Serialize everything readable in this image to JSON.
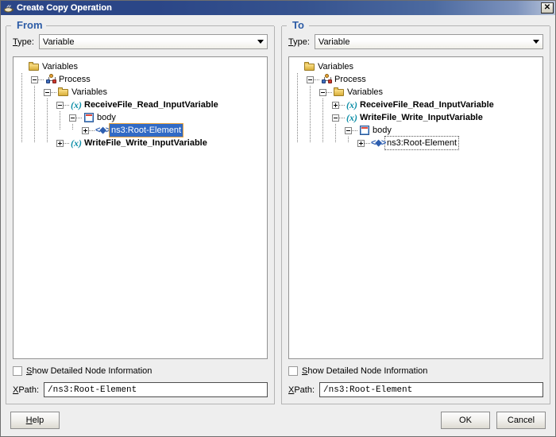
{
  "window": {
    "title": "Create Copy Operation",
    "icon": "coffee-cup-icon",
    "close_label": "✕"
  },
  "panels": [
    {
      "id": "from",
      "title": "From",
      "type_label": "Type:",
      "type_mnemonic": "T",
      "type_value": "Variable",
      "tree": [
        {
          "depth": 0,
          "icon": "folder-icon",
          "label": "Variables",
          "bold": false,
          "expander": "none",
          "state": "normal"
        },
        {
          "depth": 1,
          "icon": "process-icon",
          "label": "Process",
          "bold": false,
          "expander": "minus",
          "state": "normal"
        },
        {
          "depth": 2,
          "icon": "folder-icon",
          "label": "Variables",
          "bold": false,
          "expander": "minus",
          "state": "normal"
        },
        {
          "depth": 3,
          "icon": "variable-icon",
          "label": "ReceiveFile_Read_InputVariable",
          "bold": true,
          "expander": "minus",
          "state": "normal"
        },
        {
          "depth": 4,
          "icon": "body-icon",
          "label": "body",
          "bold": false,
          "expander": "minus",
          "state": "normal"
        },
        {
          "depth": 5,
          "icon": "element-icon",
          "label": "ns3:Root-Element",
          "bold": false,
          "expander": "plus",
          "state": "selected"
        },
        {
          "depth": 3,
          "icon": "variable-icon",
          "label": "WriteFile_Write_InputVariable",
          "bold": true,
          "expander": "plus",
          "state": "normal"
        }
      ],
      "checkbox_label": "Show Detailed Node Information",
      "checkbox_mnemonic": "S",
      "checkbox_checked": false,
      "xpath_label": "XPath:",
      "xpath_mnemonic": "X",
      "xpath_value": "/ns3:Root-Element"
    },
    {
      "id": "to",
      "title": "To",
      "type_label": "Type:",
      "type_mnemonic": "T",
      "type_value": "Variable",
      "tree": [
        {
          "depth": 0,
          "icon": "folder-icon",
          "label": "Variables",
          "bold": false,
          "expander": "none",
          "state": "normal"
        },
        {
          "depth": 1,
          "icon": "process-icon",
          "label": "Process",
          "bold": false,
          "expander": "minus",
          "state": "normal"
        },
        {
          "depth": 2,
          "icon": "folder-icon",
          "label": "Variables",
          "bold": false,
          "expander": "minus",
          "state": "normal"
        },
        {
          "depth": 3,
          "icon": "variable-icon",
          "label": "ReceiveFile_Read_InputVariable",
          "bold": true,
          "expander": "plus",
          "state": "normal"
        },
        {
          "depth": 3,
          "icon": "variable-icon",
          "label": "WriteFile_Write_InputVariable",
          "bold": true,
          "expander": "minus",
          "state": "normal"
        },
        {
          "depth": 4,
          "icon": "body-icon",
          "label": "body",
          "bold": false,
          "expander": "minus",
          "state": "normal"
        },
        {
          "depth": 5,
          "icon": "element-icon",
          "label": "ns3:Root-Element",
          "bold": false,
          "expander": "plus",
          "state": "focused"
        }
      ],
      "checkbox_label": "Show Detailed Node Information",
      "checkbox_mnemonic": "S",
      "checkbox_checked": false,
      "xpath_label": "XPath:",
      "xpath_mnemonic": "X",
      "xpath_value": "/ns3:Root-Element"
    }
  ],
  "footer": {
    "help_label": "Help",
    "help_mnemonic": "H",
    "ok_label": "OK",
    "cancel_label": "Cancel"
  },
  "colors": {
    "titlebar": "#2b4687",
    "group_title": "#2d5ca6",
    "selection": "#316ac5",
    "selection_focus_border": "#e8a33d",
    "dialog_bg": "#eeeeee",
    "variable_icon": "#0f8fa8",
    "element_icon": "#2e5fb0"
  }
}
